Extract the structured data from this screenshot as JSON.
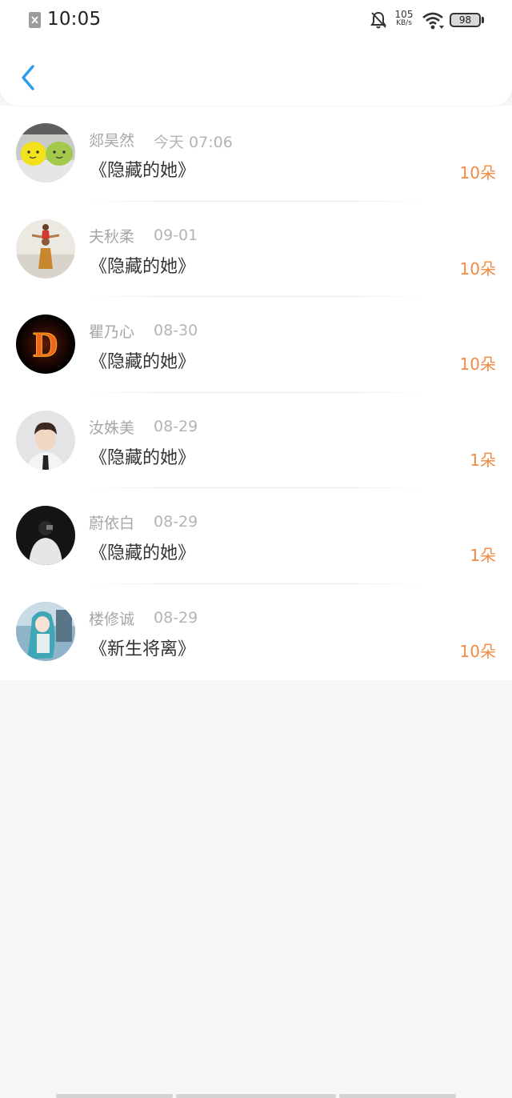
{
  "status_bar": {
    "time": "10:05",
    "speed_value": "105",
    "speed_unit": "KB/s",
    "battery": "98"
  },
  "header": {
    "back_icon": "chevron-left-icon",
    "accent_color": "#2d9be8"
  },
  "gifts": [
    {
      "name": "郯昊然",
      "date": "今天 07:06",
      "book": "《隐藏的她》",
      "amount": "10朵",
      "avatar": "two-green-yellow-blobs"
    },
    {
      "name": "夫秋柔",
      "date": "09-01",
      "book": "《隐藏的她》",
      "amount": "10朵",
      "avatar": "child-on-shoulders-photo"
    },
    {
      "name": "瞿乃心",
      "date": "08-30",
      "book": "《隐藏的她》",
      "amount": "10朵",
      "avatar": "fiery-letter-d"
    },
    {
      "name": "汝姝美",
      "date": "08-29",
      "book": "《隐藏的她》",
      "amount": "1朵",
      "avatar": "boy-in-suit-photo"
    },
    {
      "name": "蔚依白",
      "date": "08-29",
      "book": "《隐藏的她》",
      "amount": "1朵",
      "avatar": "man-in-white-coat-photo"
    },
    {
      "name": "楼修诚",
      "date": "08-29",
      "book": "《新生将离》",
      "amount": "10朵",
      "avatar": "anime-girl-teal-hair"
    }
  ],
  "colors": {
    "amount": "#f08a45",
    "name": "#a6a6a6",
    "book": "#333333",
    "background": "#f7f6f7"
  }
}
